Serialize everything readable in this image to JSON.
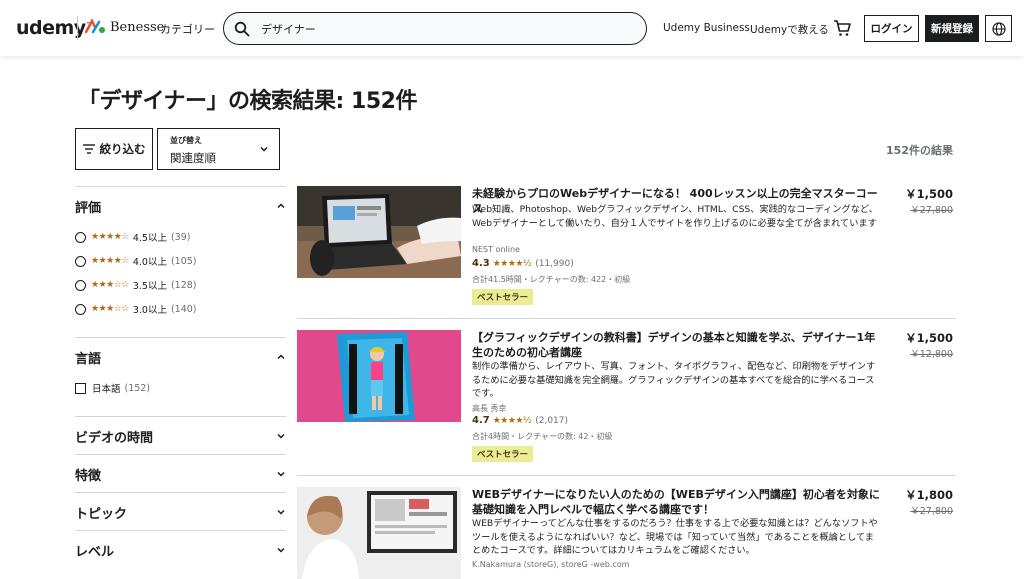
{
  "header": {
    "logo_text": "udemy",
    "partner_name": "Benesse",
    "categories_label": "カテゴリー",
    "search_value": "デザイナー",
    "business_link": "Udemy Business",
    "teach_link": "Udemyで教える",
    "login_label": "ログイン",
    "signup_label": "新規登録"
  },
  "page_title": "「デザイナー」の検索結果: 152件",
  "filter_label": "絞り込む",
  "sort": {
    "label": "並び替え",
    "value": "関連度順"
  },
  "result_count": "152件の結果",
  "sidebar": {
    "rating": {
      "title": "評価",
      "options": [
        {
          "stars": "★★★★☆",
          "label": "4.5以上",
          "count": "(39)"
        },
        {
          "stars": "★★★★☆",
          "label": "4.0以上",
          "count": "(105)"
        },
        {
          "stars": "★★★☆☆",
          "label": "3.5以上",
          "count": "(128)"
        },
        {
          "stars": "★★★☆☆",
          "label": "3.0以上",
          "count": "(140)"
        }
      ]
    },
    "language": {
      "title": "言語",
      "options": [
        {
          "label": "日本語",
          "count": "(152)"
        }
      ]
    },
    "video_length": {
      "title": "ビデオの時間"
    },
    "features": {
      "title": "特徴"
    },
    "topic": {
      "title": "トピック"
    },
    "level": {
      "title": "レベル"
    }
  },
  "courses": [
    {
      "title": "未経験からプロのWebデザイナーになる！ 400レッスン以上の完全マスターコース",
      "description": "Web知識、Photoshop、Webグラフィックデザイン、HTML、CSS、実践的なコーディングなど、Webデザイナーとして働いたり、自分１人でサイトを作り上げるのに必要な全てが含まれています",
      "author": "NEST online",
      "rating": "4.3",
      "stars": "★★★★½",
      "reviews": "(11,990)",
      "meta": "合計41.5時間・レクチャーの数: 422・初級",
      "badge": "ベストセラー",
      "price": "￥1,500",
      "original_price": "￥27,800"
    },
    {
      "title": "【グラフィックデザインの教科書】デザインの基本と知識を学ぶ、デザイナー1年生のための初心者講座",
      "description": "制作の準備から、レイアウト、写真、フォント、タイポグラフィ、配色など、印刷物をデザインするために必要な基礎知識を完全網羅。グラフィックデザインの基本すべてを総合的に学べるコースです。",
      "author": "高長 秀幸",
      "rating": "4.7",
      "stars": "★★★★½",
      "reviews": "(2,017)",
      "meta": "合計4時間・レクチャーの数: 42・初級",
      "badge": "ベストセラー",
      "price": "￥1,500",
      "original_price": "￥12,800"
    },
    {
      "title": "WEBデザイナーになりたい人のための【WEBデザイン入門講座】初心者を対象に基礎知識を入門レベルで幅広く学べる講座です！",
      "description": "WEBデザイナーってどんな仕事をするのだろう？仕事をする上で必要な知識とは？どんなソフトやツールを使えるようになればいい？など、現場では「知っていて当然」であることを概論としてまとめたコースです。詳細についてはカリキュラムをご確認ください。",
      "author": "K.Nakamura (storeG), storeG -web.com",
      "price": "￥1,800",
      "original_price": "￥27,800"
    }
  ]
}
